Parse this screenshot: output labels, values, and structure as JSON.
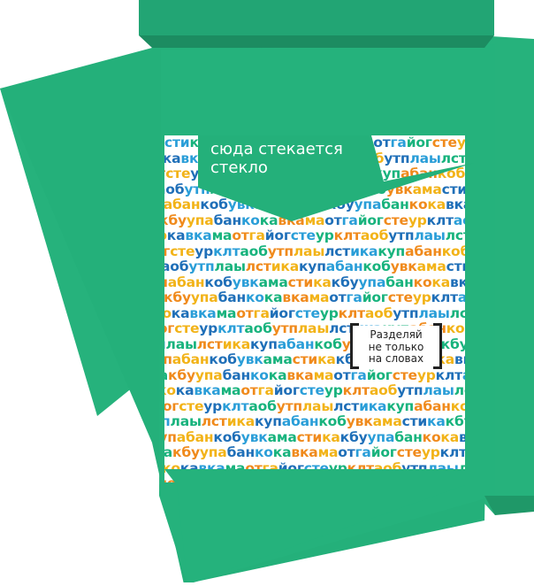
{
  "caption": {
    "line1": "сюда стекается",
    "line2": "стекло"
  },
  "badge": {
    "line1": "Разделяй",
    "line2": "не только",
    "line3": "на словах"
  },
  "letter_pattern": [
    "сти",
    "ка",
    "кбу",
    "упа",
    "бан",
    "ко",
    "ка",
    "вка",
    "ма",
    "от",
    "га",
    "йог",
    "сте",
    "ур",
    "клт",
    "аоб",
    "утп",
    "лаы",
    "лст",
    "ика",
    "куп",
    "абан",
    "коб",
    "увк",
    "ама"
  ],
  "colors": {
    "bin_green": "#24b07a",
    "bin_dark_green": "#1e8f64",
    "lid_green": "#22a273",
    "letters": [
      "#2a9ed8",
      "#f2b318",
      "#18b37d",
      "#1f6fb8",
      "#f08a1c"
    ]
  }
}
